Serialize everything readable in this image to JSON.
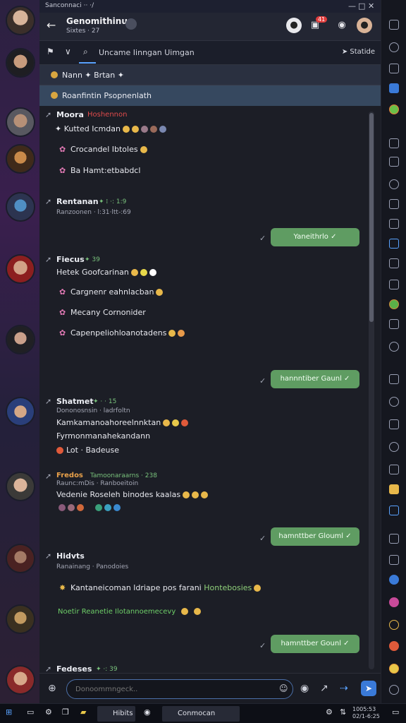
{
  "titlebar": {
    "text": "Sanconnaci ·· ·/",
    "controls": [
      "—",
      "□",
      "✕"
    ]
  },
  "header": {
    "back_icon": "arrow-left-icon",
    "title": "Genomithinun",
    "subtitle": "Sixtes · 27",
    "badge": "41"
  },
  "toolbar": {
    "search_text": "Uncame Iinngan Uimgan",
    "right_label": "Statide"
  },
  "pinned": [
    {
      "text": "Nann ✦ Brtan ✦"
    },
    {
      "text": "Roanfintin Psopnenlath"
    }
  ],
  "messages": [
    {
      "name": "Moora",
      "tag": "Hoshennon",
      "lines": [
        "✦ Kutted Icmdan",
        "Crocandel Ibtoles",
        "Ba Hamt:etbabdcl"
      ]
    },
    {
      "name": "Rentanan",
      "meta": "✦ ⁞ ·: 1:9",
      "sub": "Ranzoonen · l:31·ltt-:69"
    },
    {
      "name": "Fiecus",
      "meta": "✦ 39",
      "lines": [
        "Hetek  Goofcarinan",
        "Cargnenr eahnlacban",
        "Mecany Cornonider",
        "Capenpeliohloanotadens"
      ]
    },
    {
      "name": "Shatmet",
      "meta": "✦ · · 15",
      "sub": "Dononosnsin · ladrfoltn",
      "lines": [
        "Kamkamanoahoreelnnktan",
        "Fyrmonmanahekandann",
        "Lot · Badeuse"
      ]
    },
    {
      "name": "Fredos",
      "meta": "Tamoonaraarns · 238",
      "sub": "Raunc:mDis · Ranboeitoin",
      "lines": [
        "Vedenie Roseleh binodes kaalas"
      ]
    },
    {
      "name": "Hidvts",
      "sub": "Ranainang · Panodoies",
      "lines": [
        "Kantaneicoman ldriape pos farani",
        "Hontebosies",
        "Noetir Reanetie Ilotannoemecevy"
      ]
    },
    {
      "name": "Fedeses",
      "meta": "✦ ·: 39"
    }
  ],
  "bubbles": [
    {
      "text": "Yaneithrlo ✓"
    },
    {
      "text": "hannntiber Gaunl ✓"
    },
    {
      "text": "hamnttber Glouml ✓"
    },
    {
      "text": "hamnttber Gounl ✓"
    }
  ],
  "composer": {
    "placeholder": "Donoommngeck.."
  },
  "taskbar": {
    "items": [
      "Hibits",
      "Conmocan"
    ],
    "time": "1005:53",
    "date": "02/1-6:25"
  },
  "colors": {
    "accent": "#5aa3ff",
    "bubble": "#5f9c62",
    "meta": "#79c27c",
    "tag": "#e04b4b"
  }
}
